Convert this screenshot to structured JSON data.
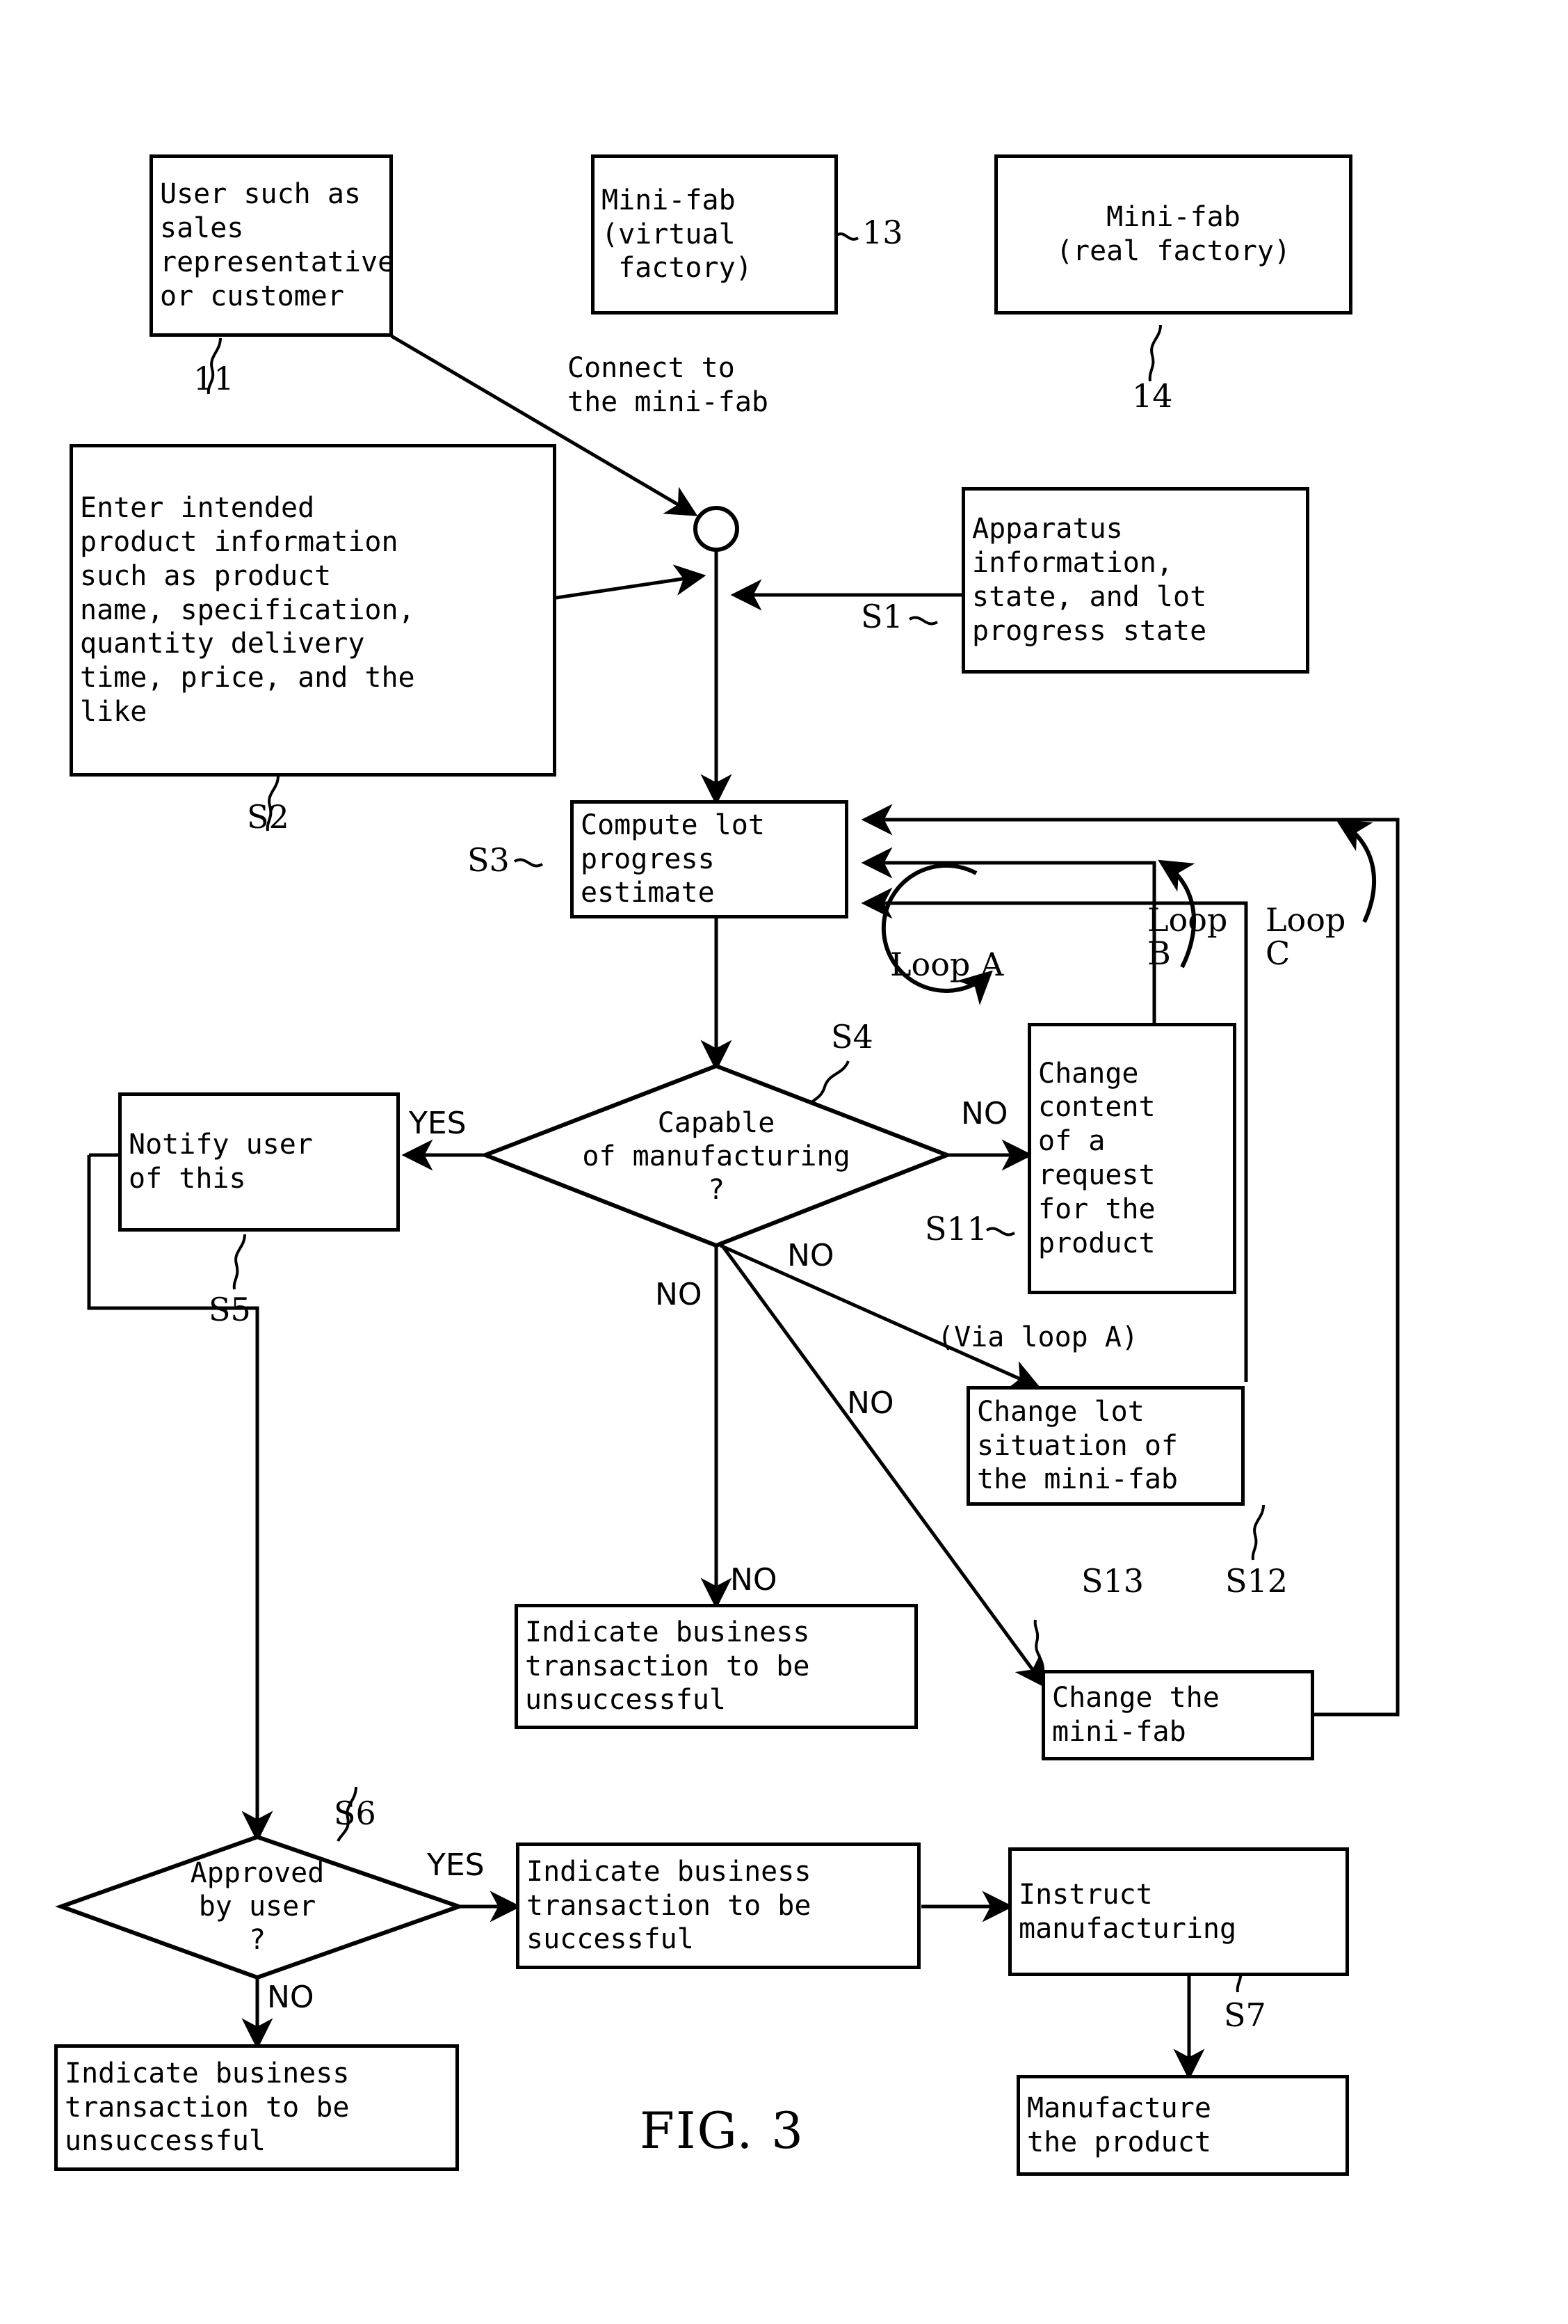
{
  "figure": {
    "caption": "FIG. 3",
    "type": "patent-flowchart"
  },
  "nodes": {
    "user": {
      "text": "User such as\nsales\nrepresentative\nor customer",
      "ref": "11"
    },
    "minifab_virtual": {
      "text": "Mini-fab\n(virtual\n factory)",
      "ref": "13"
    },
    "minifab_real": {
      "text": "Mini-fab\n(real factory)",
      "ref": "14"
    },
    "enter_info": {
      "text": "Enter intended\nproduct information\nsuch as product\nname, specification,\nquantity delivery\ntime, price, and the\nlike",
      "ref": "S2"
    },
    "apparatus_info": {
      "text": "Apparatus\ninformation,\nstate, and lot\nprogress state",
      "ref": "S1"
    },
    "compute_lot": {
      "text": "Compute lot\nprogress\nestimate",
      "ref": "S3"
    },
    "notify_user": {
      "text": "Notify user\nof this",
      "ref": "S5"
    },
    "capable": {
      "text": "Capable\nof manufacturing\n?",
      "ref": "S4"
    },
    "change_request": {
      "text": "Change\ncontent\nof a\nrequest\nfor the\nproduct",
      "ref": "S11"
    },
    "change_lot_situation": {
      "text": "Change lot\nsituation of\nthe mini-fab",
      "ref": "S12"
    },
    "change_minifab": {
      "text": "Change the\nmini-fab",
      "ref": "S13"
    },
    "unsuccessful_mid": {
      "text": "Indicate business\ntransaction to be\nunsuccessful"
    },
    "approved": {
      "text": "Approved\nby user\n?",
      "ref": "S6"
    },
    "successful": {
      "text": "Indicate business\ntransaction to be\nsuccessful"
    },
    "unsuccessful_bottom": {
      "text": "Indicate business\ntransaction to be\nunsuccessful"
    },
    "instruct_mfg": {
      "text": "Instruct\nmanufacturing",
      "ref": "S7"
    },
    "manufacture": {
      "text": "Manufacture\nthe product"
    }
  },
  "annotations": {
    "connect_to_minifab": "Connect to\nthe mini-fab",
    "loop_a": "Loop A",
    "loop_b": "Loop\nB",
    "loop_c": "Loop\nC",
    "via_loop_a": "(Via loop A)"
  },
  "edge_labels": {
    "yes_capable": "YES",
    "no_capable_right": "NO",
    "no_capable_diag1": "NO",
    "no_capable_diag2": "NO",
    "no_capable_left": "NO",
    "no_capable_down": "NO",
    "yes_approved": "YES",
    "no_approved": "NO"
  },
  "colors": {
    "ink": "#000000",
    "paper": "#ffffff"
  }
}
